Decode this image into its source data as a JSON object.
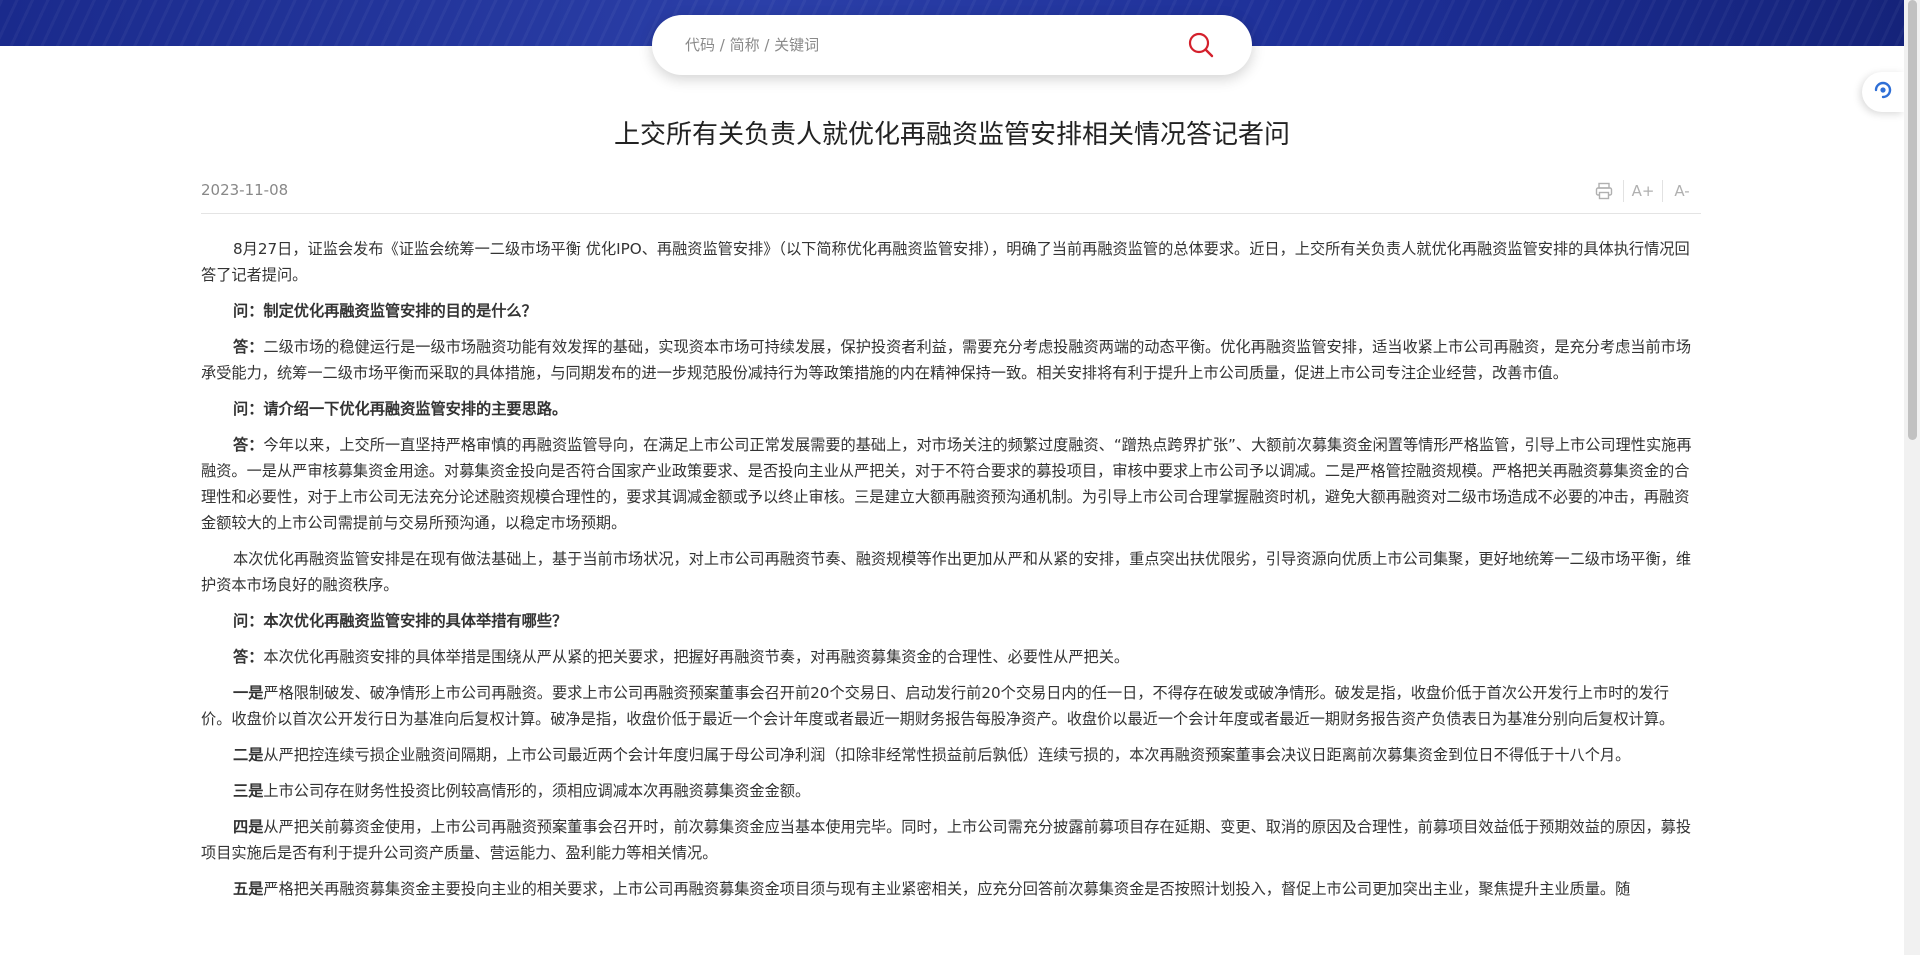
{
  "search": {
    "placeholder": "代码 / 简称 / 关键词"
  },
  "icons": {
    "search": "search-icon",
    "float": "service-icon",
    "print": "print-icon",
    "font_up": "font-increase-icon",
    "font_down": "font-decrease-icon"
  },
  "colors": {
    "banner": "#1d2f97",
    "search_icon": "#d4202c",
    "float_icon": "#2f6fd6"
  },
  "article": {
    "title": "上交所有关负责人就优化再融资监管安排相关情况答记者问",
    "date": "2023-11-08",
    "tools": {
      "font_up": "A+",
      "font_down": "A-"
    },
    "p1": "8月27日，证监会发布《证监会统筹一二级市场平衡 优化IPO、再融资监管安排》（以下简称优化再融资监管安排），明确了当前再融资监管的总体要求。近日，上交所有关负责人就优化再融资监管安排的具体执行情况回答了记者提问。",
    "q1": "问：制定优化再融资监管安排的目的是什么？",
    "a1_lead": "答：",
    "a1": "二级市场的稳健运行是一级市场融资功能有效发挥的基础，实现资本市场可持续发展，保护投资者利益，需要充分考虑投融资两端的动态平衡。优化再融资监管安排，适当收紧上市公司再融资，是充分考虑当前市场承受能力，统筹一二级市场平衡而采取的具体措施，与同期发布的进一步规范股份减持行为等政策措施的内在精神保持一致。相关安排将有利于提升上市公司质量，促进上市公司专注企业经营，改善市值。",
    "q2": "问：请介绍一下优化再融资监管安排的主要思路。",
    "a2_lead": "答：",
    "a2": "今年以来，上交所一直坚持严格审慎的再融资监管导向，在满足上市公司正常发展需要的基础上，对市场关注的频繁过度融资、“蹭热点跨界扩张”、大额前次募集资金闲置等情形严格监管，引导上市公司理性实施再融资。一是从严审核募集资金用途。对募集资金投向是否符合国家产业政策要求、是否投向主业从严把关，对于不符合要求的募投项目，审核中要求上市公司予以调减。二是严格管控融资规模。严格把关再融资募集资金的合理性和必要性，对于上市公司无法充分论述融资规模合理性的，要求其调减金额或予以终止审核。三是建立大额再融资预沟通机制。为引导上市公司合理掌握融资时机，避免大额再融资对二级市场造成不必要的冲击，再融资金额较大的上市公司需提前与交易所预沟通，以稳定市场预期。",
    "p2": "本次优化再融资监管安排是在现有做法基础上，基于当前市场状况，对上市公司再融资节奏、融资规模等作出更加从严和从紧的安排，重点突出扶优限劣，引导资源向优质上市公司集聚，更好地统筹一二级市场平衡，维护资本市场良好的融资秩序。",
    "q3": "问：本次优化再融资监管安排的具体举措有哪些？",
    "a3_lead": "答：",
    "a3": "本次优化再融资安排的具体举措是围绕从严从紧的把关要求，把握好再融资节奏，对再融资募集资金的合理性、必要性从严把关。",
    "i1_lead": "一是",
    "i1": "严格限制破发、破净情形上市公司再融资。要求上市公司再融资预案董事会召开前20个交易日、启动发行前20个交易日内的任一日，不得存在破发或破净情形。破发是指，收盘价低于首次公开发行上市时的发行价。收盘价以首次公开发行日为基准向后复权计算。破净是指，收盘价低于最近一个会计年度或者最近一期财务报告每股净资产。收盘价以最近一个会计年度或者最近一期财务报告资产负债表日为基准分别向后复权计算。",
    "i2_lead": "二是",
    "i2": "从严把控连续亏损企业融资间隔期，上市公司最近两个会计年度归属于母公司净利润（扣除非经常性损益前后孰低）连续亏损的，本次再融资预案董事会决议日距离前次募集资金到位日不得低于十八个月。",
    "i3_lead": "三是",
    "i3": "上市公司存在财务性投资比例较高情形的，须相应调减本次再融资募集资金金额。",
    "i4_lead": "四是",
    "i4": "从严把关前募资金使用，上市公司再融资预案董事会召开时，前次募集资金应当基本使用完毕。同时，上市公司需充分披露前募项目存在延期、变更、取消的原因及合理性，前募项目效益低于预期效益的原因，募投项目实施后是否有利于提升公司资产质量、营运能力、盈利能力等相关情况。",
    "i5_lead": "五是",
    "i5": "严格把关再融资募集资金主要投向主业的相关要求，上市公司再融资募集资金项目须与现有主业紧密相关，应充分回答前次募集资金是否按照计划投入，督促上市公司更加突出主业，聚焦提升主业质量。随"
  }
}
